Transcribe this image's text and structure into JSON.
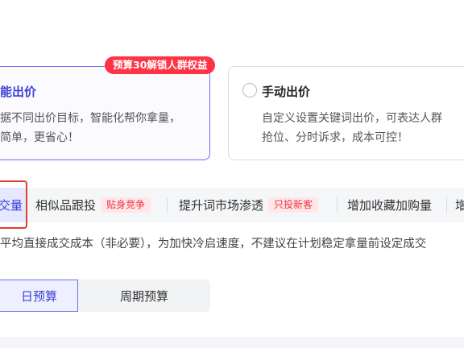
{
  "bid_modes": {
    "smart": {
      "title": "能出价",
      "promo": "预算30解锁人群权益",
      "desc_line1": "据不同出价目标，智能化帮你拿量，",
      "desc_line2": "简单，更省心！"
    },
    "manual": {
      "title": "手动出价",
      "desc_line1": "自定义设置关键词出价，可表达人群",
      "desc_line2": "抢位、分时诉求，成本可控！"
    }
  },
  "tabs": [
    {
      "label": "交量",
      "tag": ""
    },
    {
      "label": "相似品跟投",
      "tag": "贴身竞争"
    },
    {
      "label": "提升词市场渗透",
      "tag": "只投新客"
    },
    {
      "label": "增加收藏加购量",
      "tag": ""
    },
    {
      "label": "增",
      "tag": ""
    }
  ],
  "hint": "平均直接成交成本（非必要），为加快冷启速度，不建议在计划稳定拿量前设定成交",
  "budget": {
    "daily": "日预算",
    "cycle": "周期预算"
  },
  "colors": {
    "accent": "#3b3fd6",
    "promo_red": "#ff3344",
    "tag_red": "#ee3344",
    "highlight": "#e53935"
  }
}
